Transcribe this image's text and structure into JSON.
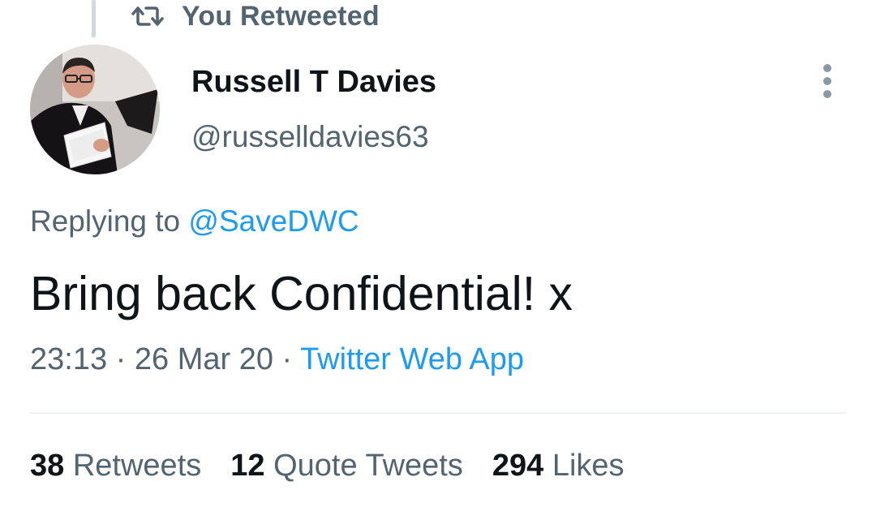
{
  "retweet_context": {
    "icon": "retweet-icon",
    "label": "You Retweeted"
  },
  "author": {
    "avatar": "avatar",
    "display_name": "Russell T Davies",
    "handle": "@russelldavies63"
  },
  "more_options": {
    "icon": "more-vertical-icon"
  },
  "reply": {
    "prefix": "Replying to",
    "mention": "@SaveDWC"
  },
  "tweet": {
    "text": "Bring back Confidential! x",
    "time": "23:13",
    "date": "26 Mar 20",
    "separator": "·",
    "source": "Twitter Web App"
  },
  "stats": {
    "retweets": {
      "count": "38",
      "label": "Retweets"
    },
    "quotes": {
      "count": "12",
      "label": "Quote Tweets"
    },
    "likes": {
      "count": "294",
      "label": "Likes"
    }
  },
  "colors": {
    "accent": "#1d9bf0",
    "secondary_text": "#536471",
    "primary_text": "#0f1419",
    "divider": "#eff3f4"
  }
}
